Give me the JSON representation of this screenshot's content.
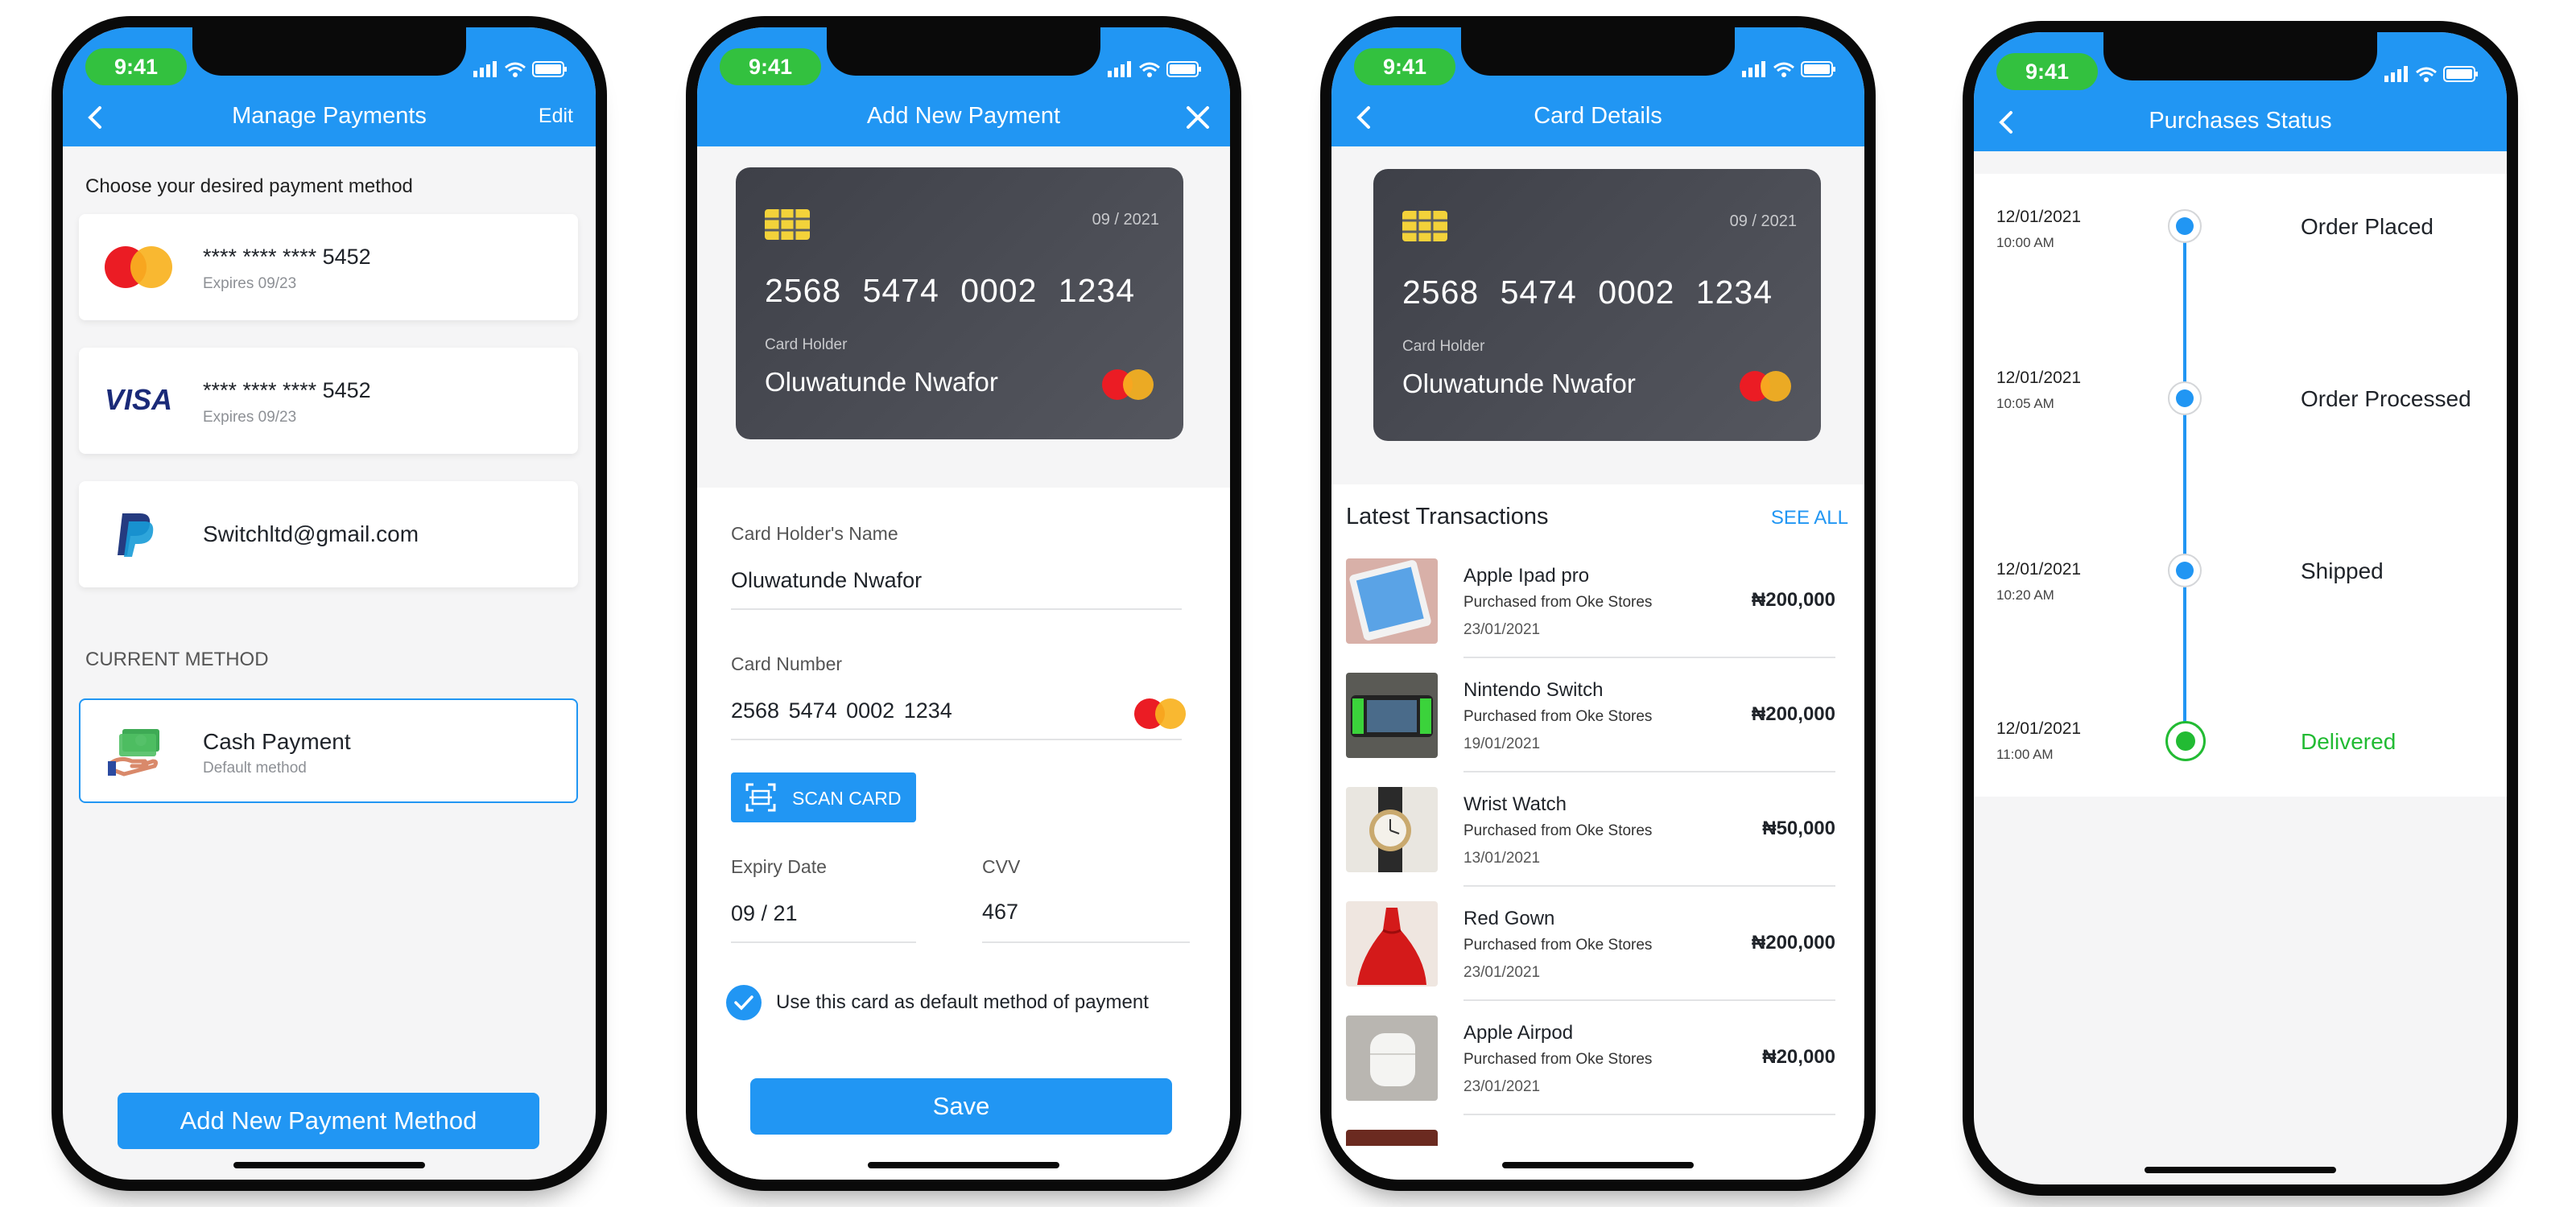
{
  "status_time": "9:41",
  "colors": {
    "primary": "#2196f3",
    "success": "#33c13f",
    "delivered": "#22bb33",
    "card_dark": "#45474f"
  },
  "screen1": {
    "title": "Manage Payments",
    "edit": "Edit",
    "subtitle": "Choose your desired payment method",
    "methods": [
      {
        "icon": "mastercard-logo",
        "number": "**** **** **** 5452",
        "expires": "Expires 09/23"
      },
      {
        "icon": "visa-logo",
        "logo_text": "VISA",
        "number": "**** **** **** 5452",
        "expires": "Expires 09/23"
      },
      {
        "icon": "paypal-logo",
        "email": "Switchltd@gmail.com"
      }
    ],
    "current_label": "CURRENT METHOD",
    "current": {
      "icon": "cash-hand-icon",
      "name": "Cash Payment",
      "desc": "Default method"
    },
    "add_button": "Add New Payment Method"
  },
  "card": {
    "expiry": "09 / 2021",
    "number": "2568  5474  0002  1234",
    "holder_label": "Card Holder",
    "holder": "Oluwatunde Nwafor"
  },
  "screen2": {
    "title": "Add New Payment",
    "name_label": "Card Holder's Name",
    "name_value": "Oluwatunde Nwafor",
    "number_label": "Card Number",
    "number_value": "2568   5474   0002   1234",
    "scan_label": "SCAN CARD",
    "expiry_label": "Expiry Date",
    "expiry_value": "09 / 21",
    "cvv_label": "CVV",
    "cvv_value": "467",
    "default_label": "Use this card as default method of payment",
    "default_checked": true,
    "save": "Save"
  },
  "screen3": {
    "title": "Card Details",
    "latest": "Latest Transactions",
    "see_all": "SEE ALL",
    "transactions": [
      {
        "name": "Apple Ipad pro",
        "store": "Purchased from Oke Stores",
        "date": "23/01/2021",
        "amount": "₦200,000"
      },
      {
        "name": "Nintendo Switch",
        "store": "Purchased from Oke Stores",
        "date": "19/01/2021",
        "amount": "₦200,000"
      },
      {
        "name": "Wrist Watch",
        "store": "Purchased from Oke Stores",
        "date": "13/01/2021",
        "amount": "₦50,000"
      },
      {
        "name": "Red Gown",
        "store": "Purchased from Oke Stores",
        "date": "23/01/2021",
        "amount": "₦200,000"
      },
      {
        "name": "Apple Airpod",
        "store": "Purchased from Oke Stores",
        "date": "23/01/2021",
        "amount": "₦20,000"
      }
    ]
  },
  "screen4": {
    "title": "Purchases Status",
    "steps": [
      {
        "date": "12/01/2021",
        "time": "10:00 AM",
        "label": "Order Placed",
        "state": "done"
      },
      {
        "date": "12/01/2021",
        "time": "10:05 AM",
        "label": "Order Processed",
        "state": "done"
      },
      {
        "date": "12/01/2021",
        "time": "10:20 AM",
        "label": "Shipped",
        "state": "done"
      },
      {
        "date": "12/01/2021",
        "time": "11:00 AM",
        "label": "Delivered",
        "state": "delivered"
      }
    ]
  }
}
